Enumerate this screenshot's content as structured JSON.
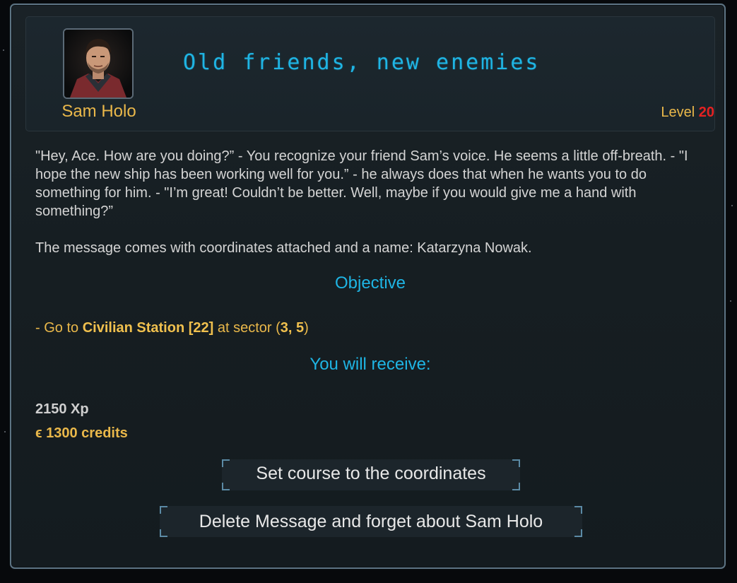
{
  "mission": {
    "giver_name": "Sam Holo",
    "title": "Old friends, new enemies",
    "level_label": "Level",
    "level_value": "20"
  },
  "message": {
    "paragraph_1": "\"Hey, Ace. How are you doing?” - You recognize your friend Sam’s voice. He seems a little off-breath. - \"I hope the new ship has been working well for you.” - he always does that when he wants you to do something for him. - \"I’m great! Couldn’t be better. Well, maybe if you would give me a hand with something?”",
    "paragraph_2": "The message comes with coordinates attached and a name: Katarzyna Nowak."
  },
  "objective": {
    "heading": "Objective",
    "prefix": "- Go to ",
    "destination": "Civilian Station [22]",
    "middle": " at sector (",
    "sector": "3, 5",
    "suffix": ")"
  },
  "rewards": {
    "heading": "You will receive:",
    "xp": "2150 Xp",
    "credits": "ϵ 1300 credits"
  },
  "buttons": {
    "set_course": "Set course to the coordinates",
    "delete": "Delete Message and forget about Sam Holo"
  },
  "icons": {
    "portrait": "npc-portrait"
  },
  "colors": {
    "accent": "#1fb5e4",
    "gold": "#eab84a",
    "level_red": "#e42222"
  }
}
